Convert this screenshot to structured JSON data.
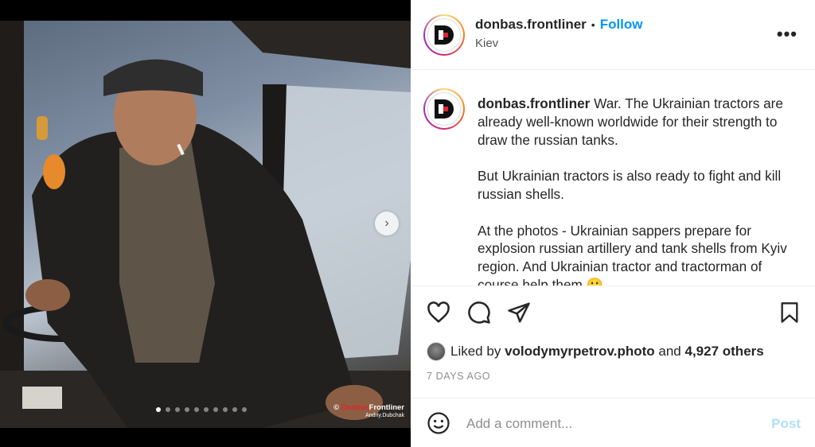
{
  "post": {
    "username": "donbas.frontliner",
    "separator": "•",
    "follow_label": "Follow",
    "location": "Kiev",
    "more_label": "•••"
  },
  "media": {
    "slide_count": 9,
    "active_slide": 0,
    "next_label": "›",
    "watermark_brand_prefix": "©",
    "watermark_brand_red": "Donbas",
    "watermark_brand": "Frontliner",
    "watermark_author": "Andriy.Dubchak"
  },
  "caption": {
    "username": "donbas.frontliner",
    "paragraph1": "War. The Ukrainian tractors are already well-known worldwide for their strength to draw the russian tanks.",
    "paragraph2": "But Ukrainian tractors is also ready to fight and kill russian shells.",
    "paragraph3": "At the photos - Ukrainian sappers prepare for explosion russian artillery and tank shells from Kyiv region. And Ukrainian tractor and tractorman of course help them 🙂"
  },
  "likes": {
    "prefix": "Liked by",
    "user": "volodymyrpetrov.photo",
    "middle": "and",
    "count": "4,927 others"
  },
  "date": "7 DAYS AGO",
  "comment": {
    "placeholder": "Add a comment...",
    "post_label": "Post"
  },
  "icons": {
    "like": "heart-icon",
    "comment": "comment-icon",
    "share": "share-icon",
    "save": "bookmark-icon",
    "emoji": "emoji-icon"
  },
  "colors": {
    "follow": "#0095f6",
    "post_disabled": "#b2dffc",
    "watermark_red": "#e0242d"
  }
}
